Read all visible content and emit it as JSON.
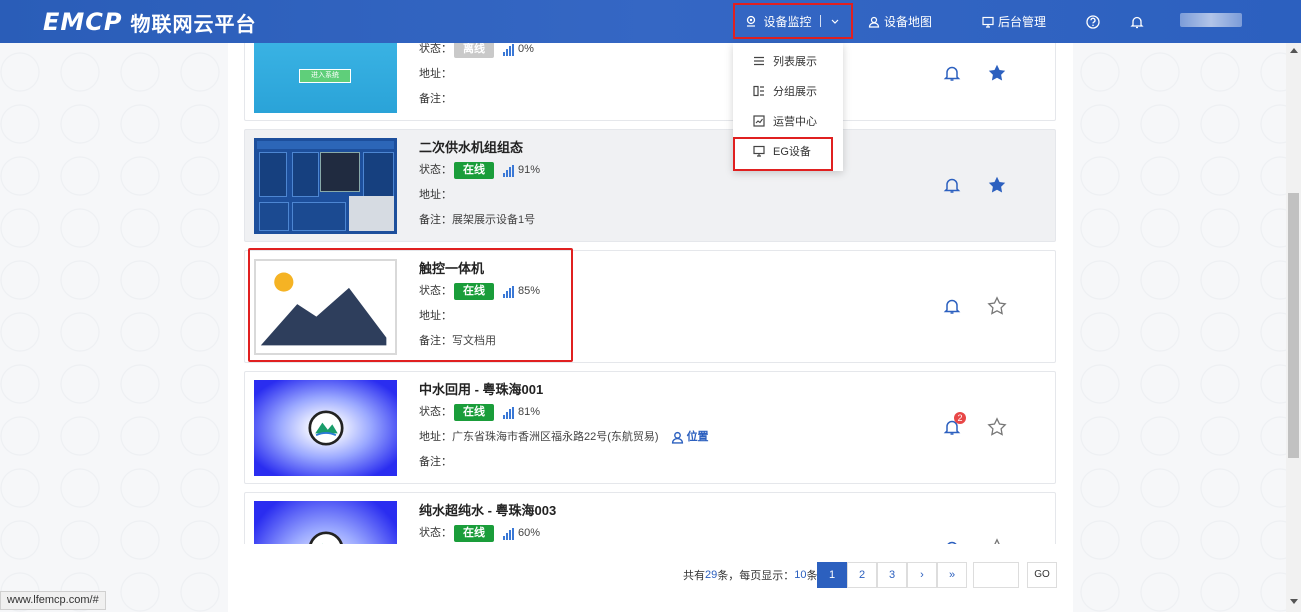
{
  "header": {
    "logo_mark": "EMCP",
    "logo_text": "物联网云平台",
    "nav_monitor": "设备监控",
    "nav_map": "设备地图",
    "nav_admin": "后台管理"
  },
  "dropdown": {
    "items": [
      {
        "label": "列表展示",
        "icon": "list-icon"
      },
      {
        "label": "分组展示",
        "icon": "group-icon"
      },
      {
        "label": "运营中心",
        "icon": "chart-icon"
      },
      {
        "label": "EG设备",
        "icon": "monitor-icon"
      }
    ]
  },
  "labels": {
    "status": "状态：",
    "address": "地址：",
    "remark": "备注："
  },
  "devices": [
    {
      "title": "",
      "status": "离线",
      "online": false,
      "signal": "0%",
      "address": "",
      "remark": "",
      "thumb_text": "进入系统"
    },
    {
      "title": "二次供水机组组态",
      "status": "在线",
      "online": true,
      "signal": "91%",
      "address": "",
      "remark": "展架展示设备1号"
    },
    {
      "title": "触控一体机",
      "status": "在线",
      "online": true,
      "signal": "85%",
      "address": "",
      "remark": "写文档用"
    },
    {
      "title": "中水回用 - 粤珠海001",
      "status": "在线",
      "online": true,
      "signal": "81%",
      "address": "广东省珠海市香洲区福永路22号(东航贸易)",
      "remark": "",
      "location_label": "位置",
      "notifications": "2"
    },
    {
      "title": "纯水超纯水 - 粤珠海003",
      "status": "在线",
      "online": true,
      "signal": "60%",
      "address": "",
      "remark": ""
    }
  ],
  "pagination": {
    "prefix": "共有",
    "total": "29",
    "mid": "条，每页显示：",
    "page_size": "10",
    "suffix": "条",
    "pages": [
      "1",
      "2",
      "3"
    ],
    "next": "›",
    "last": "»",
    "go": "GO"
  },
  "statusbar": {
    "url": "www.lfemcp.com/#"
  }
}
